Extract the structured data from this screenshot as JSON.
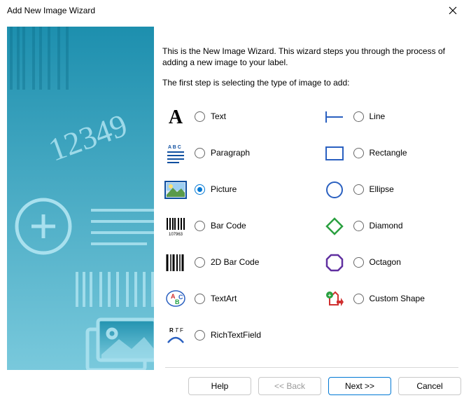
{
  "window_title": "Add New Image Wizard",
  "intro_text": "This is the New Image Wizard.  This wizard steps you through the process of adding a new image to your label.",
  "step_text": "The first step is selecting the type of image to add:",
  "options_left": [
    {
      "key": "text",
      "label": "Text",
      "selected": false
    },
    {
      "key": "paragraph",
      "label": "Paragraph",
      "selected": false
    },
    {
      "key": "picture",
      "label": "Picture",
      "selected": true
    },
    {
      "key": "barcode",
      "label": "Bar Code",
      "selected": false
    },
    {
      "key": "barcode2d",
      "label": "2D Bar Code",
      "selected": false
    },
    {
      "key": "textart",
      "label": "TextArt",
      "selected": false
    },
    {
      "key": "richtext",
      "label": "RichTextField",
      "selected": false
    }
  ],
  "options_right": [
    {
      "key": "line",
      "label": "Line",
      "selected": false
    },
    {
      "key": "rectangle",
      "label": "Rectangle",
      "selected": false
    },
    {
      "key": "ellipse",
      "label": "Ellipse",
      "selected": false
    },
    {
      "key": "diamond",
      "label": "Diamond",
      "selected": false
    },
    {
      "key": "octagon",
      "label": "Octagon",
      "selected": false
    },
    {
      "key": "customshape",
      "label": "Custom Shape",
      "selected": false
    }
  ],
  "buttons": {
    "help": "Help",
    "back": "<< Back",
    "next": "Next >>",
    "cancel": "Cancel"
  }
}
